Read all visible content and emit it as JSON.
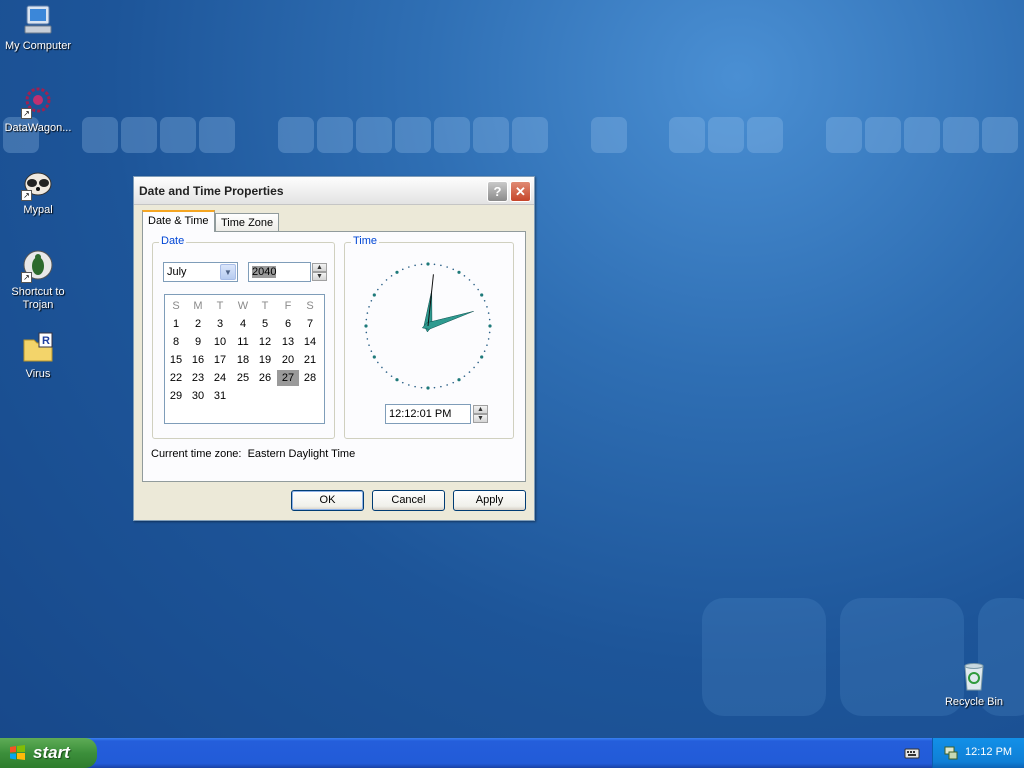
{
  "desktop": {
    "icons": [
      {
        "label": "My Computer",
        "icon": "my-computer-icon"
      },
      {
        "label": "DataWagon...",
        "icon": "datawagon-icon"
      },
      {
        "label": "Mypal",
        "icon": "mypal-icon"
      },
      {
        "label": "Shortcut to Trojan",
        "icon": "trojan-shortcut-icon"
      },
      {
        "label": "Virus",
        "icon": "virus-folder-icon"
      },
      {
        "label": "Recycle Bin",
        "icon": "recycle-bin-icon"
      }
    ]
  },
  "dialog": {
    "title": "Date and Time Properties",
    "help_button": "?",
    "close_button": "✕",
    "tabs": [
      {
        "label": "Date & Time",
        "active": true
      },
      {
        "label": "Time Zone",
        "active": false
      }
    ],
    "date_group": {
      "legend": "Date",
      "month": "July",
      "year": "2040",
      "weekdays": [
        "S",
        "M",
        "T",
        "W",
        "T",
        "F",
        "S"
      ],
      "weeks": [
        [
          "",
          "1",
          "2",
          "3",
          "4",
          "5",
          "6",
          "7"
        ],
        [
          "8",
          "9",
          "10",
          "11",
          "12",
          "13",
          "14"
        ],
        [
          "15",
          "16",
          "17",
          "18",
          "19",
          "20",
          "21"
        ],
        [
          "22",
          "23",
          "24",
          "25",
          "26",
          "27",
          "28"
        ],
        [
          "29",
          "30",
          "31"
        ]
      ],
      "selected_day": "27"
    },
    "time_group": {
      "legend": "Time",
      "time_value": "12:12:01 PM"
    },
    "timezone_text": "Current time zone:  Eastern Daylight Time",
    "buttons": {
      "ok": "OK",
      "cancel": "Cancel",
      "apply": "Apply"
    }
  },
  "taskbar": {
    "start_label": "start",
    "clock": "12:12 PM"
  }
}
